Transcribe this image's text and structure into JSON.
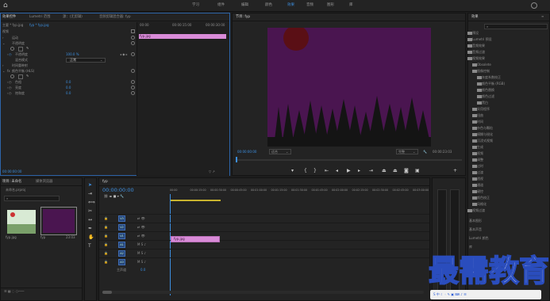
{
  "workspaces": [
    {
      "label": "学习",
      "active": false
    },
    {
      "label": "组件",
      "active": false
    },
    {
      "label": "编辑",
      "active": false
    },
    {
      "label": "颜色",
      "active": false
    },
    {
      "label": "效果",
      "active": true
    },
    {
      "label": "音频",
      "active": false
    },
    {
      "label": "图形",
      "active": false
    },
    {
      "label": "库",
      "active": false
    }
  ],
  "source_tabs": [
    {
      "label": "效果控件",
      "active": true
    },
    {
      "label": "Lumetri 范围",
      "active": false
    },
    {
      "label": "源：(无剪辑)",
      "active": false
    },
    {
      "label": "音频剪辑混合器: fyp",
      "active": false
    }
  ],
  "effect_controls": {
    "master": "主要 * fyp.jpg",
    "seq": "fyp * fyp.jpg",
    "section": "视频",
    "timecodes": [
      "00:00",
      "00:00:15:00",
      "00:00:30:00"
    ],
    "clip_label": "fyp.jpg",
    "rows": [
      {
        "label": "运动",
        "value": ""
      },
      {
        "label": "不透明度",
        "value": ""
      },
      {
        "label": "不透明度",
        "value": "100.0 %"
      },
      {
        "label": "混合模式",
        "value": "正常"
      },
      {
        "label": "时间重映射",
        "value": ""
      },
      {
        "label": "颜色平衡 (HLS)",
        "value": ""
      },
      {
        "label": "色相",
        "value": "0.0"
      },
      {
        "label": "亮度",
        "value": "0.0"
      },
      {
        "label": "饱和度",
        "value": "0.0"
      }
    ],
    "time": "00:00:00:00"
  },
  "program": {
    "title": "节目: fyp",
    "timecode": "00:00:00:00",
    "fit": "适合",
    "quality": "完整",
    "duration": "00:00:23:03"
  },
  "project": {
    "tabs": [
      "项目: 未命名",
      "媒体浏览器"
    ],
    "file": "未命名.prproj",
    "items": [
      {
        "name": "fyp.jpg",
        "duration": ""
      },
      {
        "name": "fyp",
        "duration": "23:03"
      }
    ]
  },
  "timeline": {
    "tab": "fyp",
    "timecode": "00:00:00:00",
    "ticks": [
      "00:00",
      "00:00:15:00",
      "00:00:30:00",
      "00:00:45:00",
      "00:01:00:00",
      "00:01:15:00",
      "00:01:30:00",
      "00:01:45:00",
      "00:02:00:00",
      "00:02:15:00",
      "00:02:30:00",
      "00:02:45:00",
      "00:03:00:00"
    ],
    "tracks": [
      "V3",
      "V2",
      "V1",
      "A1",
      "A2",
      "A3"
    ],
    "master": "主声道",
    "master_val": "0.0",
    "clip": "fyp.jpg"
  },
  "effects_panel": {
    "title": "效果",
    "items": [
      "预设",
      "Lumetri 预设",
      "音频效果",
      "音频过渡",
      "视频效果",
      "Obsolete",
      "图像控制",
      "灰度系数校正",
      "颜色平衡 (RGB)",
      "颜色替换",
      "颜色过滤",
      "黑白",
      "实用程序",
      "扭曲",
      "时间",
      "杂色与颗粒",
      "模糊与锐化",
      "沉浸式视频",
      "生成",
      "视频",
      "调整",
      "过时",
      "过渡",
      "透视",
      "通道",
      "键控",
      "颜色校正",
      "风格化",
      "视频过渡"
    ],
    "bottom": [
      "基本图形",
      "基本声音",
      "Lumetri 颜色",
      "库"
    ]
  },
  "watermark": "最需教育",
  "colors": {
    "accent": "#3d8fe0",
    "clip": "#d98bd8",
    "purple": "#4a1550",
    "sun": "#5a0f15",
    "trees": "#141414"
  }
}
